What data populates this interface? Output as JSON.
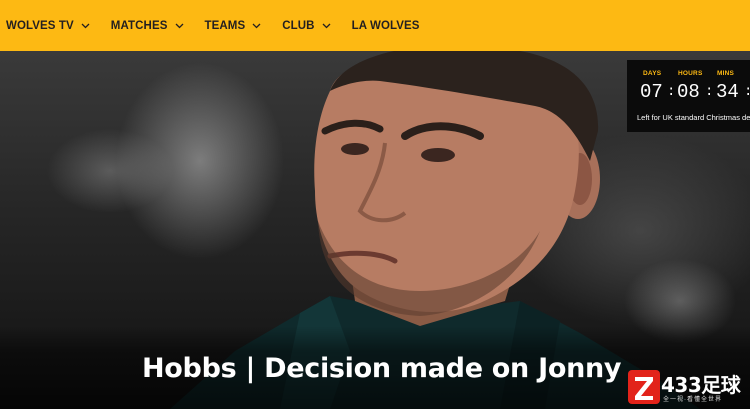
{
  "nav": {
    "items": [
      {
        "label": "WOLVES TV",
        "has_dropdown": true
      },
      {
        "label": "MATCHES",
        "has_dropdown": true
      },
      {
        "label": "TEAMS",
        "has_dropdown": true
      },
      {
        "label": "CLUB",
        "has_dropdown": true
      },
      {
        "label": "LA WOLVES",
        "has_dropdown": false
      }
    ]
  },
  "countdown": {
    "labels": {
      "days": "DAYS",
      "hours": "HOURS",
      "mins": "MINS"
    },
    "values": {
      "days": "07",
      "hours": "08",
      "mins": "34"
    },
    "separator": ":",
    "caption": "Left for UK standard Christmas de"
  },
  "hero": {
    "headline": "Hobbs | Decision made on Jonny"
  },
  "watermark": {
    "text": "433足球",
    "subtext": "全一视·看懂全世界"
  },
  "colors": {
    "brand_gold": "#fdb913",
    "nav_text": "#231f20",
    "watermark_red": "#e2231a"
  }
}
